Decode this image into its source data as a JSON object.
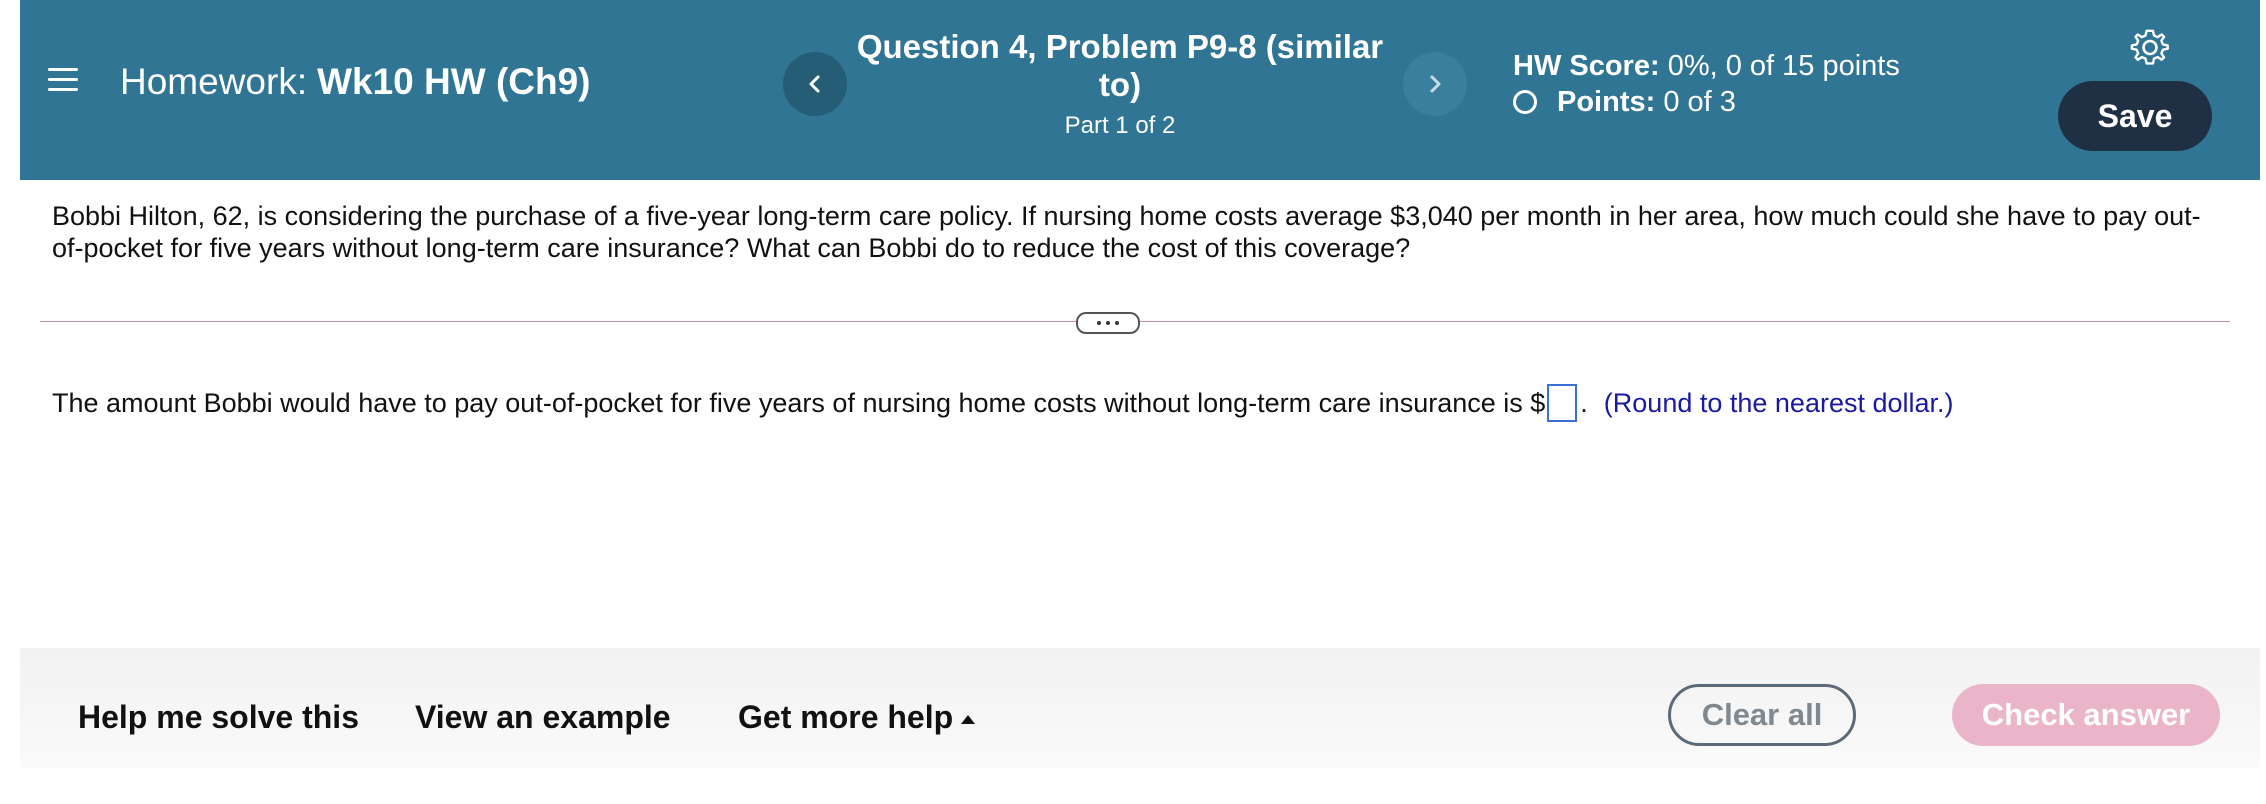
{
  "header": {
    "homework_prefix": "Homework:",
    "homework_name": "Wk10 HW (Ch9)",
    "question_title": "Question 4, Problem P9-8 (similar to)",
    "part": "Part 1 of 2",
    "hw_score_label": "HW Score:",
    "hw_score_value": "0%, 0 of 15 points",
    "points_label": "Points:",
    "points_value": "0 of 3",
    "save_label": "Save",
    "prev_icon": "chevron-left-icon",
    "next_icon": "chevron-right-icon",
    "settings_icon": "gear-icon",
    "menu_icon": "hamburger-menu-icon"
  },
  "question": {
    "text": "Bobbi Hilton, 62, is considering the purchase of a five-year long-term care policy. If nursing home costs average $3,040 per month in her area, how much could she have to pay out-of-pocket for five years without long-term care insurance? What can Bobbi do to reduce the cost of this coverage?",
    "answer_prefix": "The amount Bobbi would have to pay out-of-pocket for five years of nursing home costs without long-term care insurance is $",
    "answer_value": "",
    "answer_suffix": ".",
    "hint": "(Round to the nearest dollar.)"
  },
  "footer": {
    "help_me_solve": "Help me solve this",
    "view_example": "View an example",
    "get_more_help": "Get more help",
    "clear_all": "Clear all",
    "check_answer": "Check answer"
  },
  "colors": {
    "header_bg": "#307594",
    "save_bg": "#1f3044",
    "check_answer_bg": "#eab5c9",
    "hint_text": "#1a1aa0",
    "divider": "#c58aa6"
  }
}
